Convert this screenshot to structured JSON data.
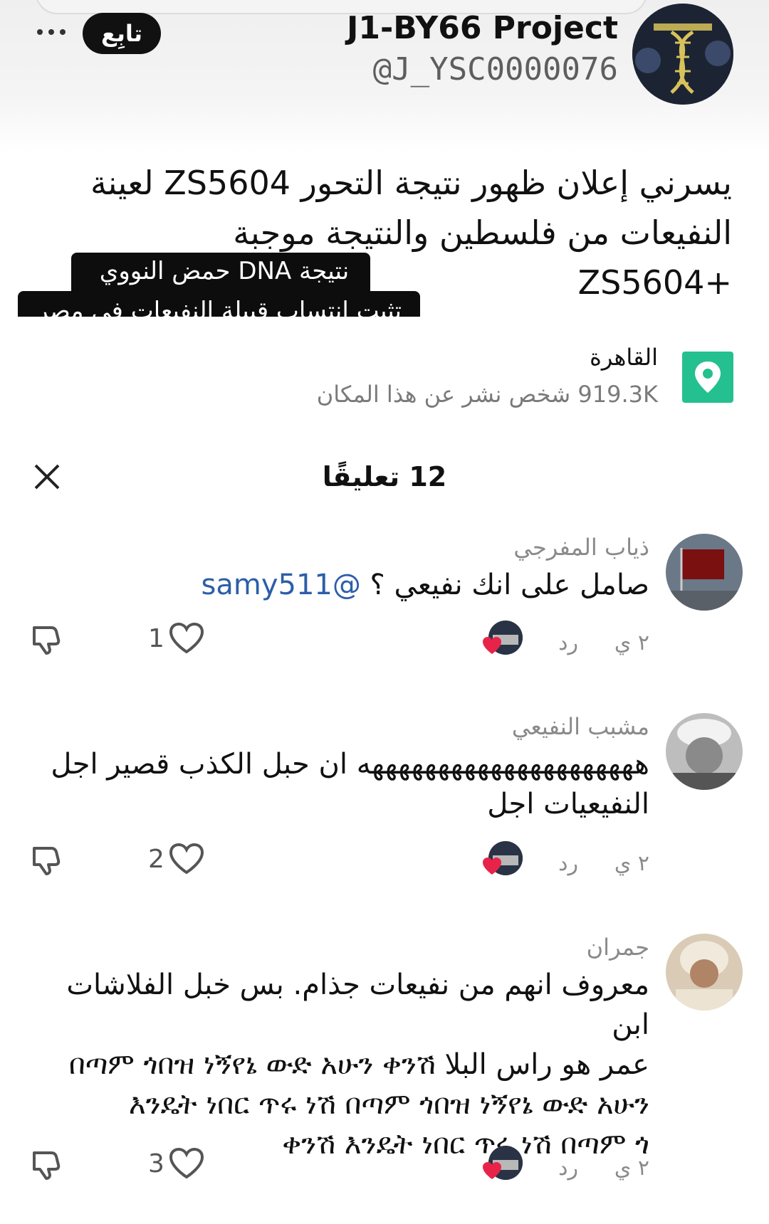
{
  "header": {
    "account_name": "J1-BY66 Project",
    "account_handle": "@J_YSC0000076",
    "follow_label": "تابِع",
    "more_icon": "more-horizontal-icon"
  },
  "post": {
    "lines": [
      "يسرني إعلان ظهور نتيجة التحور ZS5604 لعينة",
      "النفيعات من فلسطين والنتيجة موجبة",
      "+ZS5604"
    ],
    "overlay_caption": {
      "line1": "نتيجة DNA حمض النووي",
      "line2": "تثبت انتساب قبيلة النفيعات في مصر"
    }
  },
  "location": {
    "icon": "location-pin-icon",
    "name": "القاهرة",
    "posts_count": "919.3K",
    "posts_label": "شخص نشر عن هذا المكان"
  },
  "comments_panel": {
    "count": "12",
    "title": "تعليقًا",
    "close_icon": "close-icon"
  },
  "comments": [
    {
      "username": "ذياب المفرجي",
      "lines": [
        "صامل على انك نفيعي ؟ @samy511"
      ],
      "mention": "@samy511",
      "time": "٢ ي",
      "reply_label": "رد",
      "likes": "1"
    },
    {
      "username": "مشبب النفيعي",
      "lines": [
        "هههههههههههههههههههههه ان حبل الكذب قصير اجل",
        "النفيعيات اجل"
      ],
      "time": "٢ ي",
      "reply_label": "رد",
      "likes": "2"
    },
    {
      "username": "جمران",
      "lines": [
        "معروف انهم من نفيعات جذام. بس خبل الفلاشات ابن",
        "عمر هو راس البلا በጣም ጎበዝ ነኝየኔ ውድ አሁን ቀንሽ",
        "እንዴት ነበር ጥሩ ነሽ በጣም ጎበዝ ነኝየኔ ውድ አሁን",
        "ቀንሽ እንዴት ነበር ጥሩ ነሽ በጣም ጎ"
      ],
      "time": "٢ ي",
      "reply_label": "رد",
      "likes": "3"
    }
  ],
  "colors": {
    "location_icon": "#25c08f",
    "mention": "#2c5ea8",
    "liked_heart": "#e8234a"
  }
}
